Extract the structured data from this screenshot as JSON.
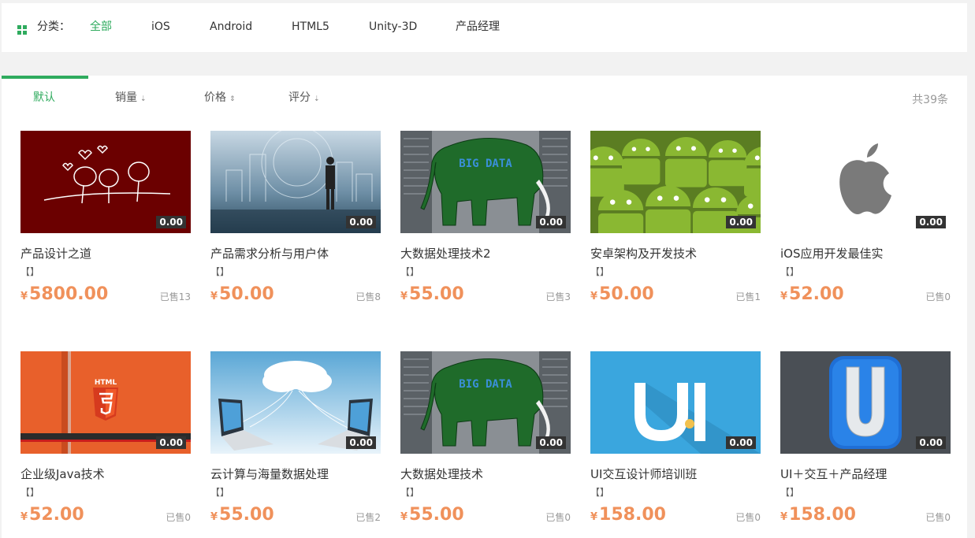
{
  "category": {
    "label": "分类：",
    "items": [
      {
        "label": "全部",
        "active": true
      },
      {
        "label": "iOS",
        "active": false
      },
      {
        "label": "Android",
        "active": false
      },
      {
        "label": "HTML5",
        "active": false
      },
      {
        "label": "Unity-3D",
        "active": false
      },
      {
        "label": "产品经理",
        "active": false
      }
    ]
  },
  "sort": {
    "items": [
      {
        "label": "默认",
        "arrow": "",
        "active": true
      },
      {
        "label": "销量",
        "arrow": "⇣",
        "active": false
      },
      {
        "label": "价格",
        "arrow": "⇕",
        "active": false
      },
      {
        "label": "评分",
        "arrow": "⇣",
        "active": false
      }
    ],
    "total": "共39条"
  },
  "courses": [
    {
      "title": "产品设计之道",
      "tag": "【】",
      "currency": "¥",
      "price": "5800.00",
      "sold": "已售13",
      "rating": "0.00",
      "thumb": "sketch"
    },
    {
      "title": "产品需求分析与用户体",
      "tag": "【】",
      "currency": "¥",
      "price": "50.00",
      "sold": "已售8",
      "rating": "0.00",
      "thumb": "businessman"
    },
    {
      "title": "大数据处理技术2",
      "tag": "【】",
      "currency": "¥",
      "price": "55.00",
      "sold": "已售3",
      "rating": "0.00",
      "thumb": "bigdata"
    },
    {
      "title": "安卓架构及开发技术",
      "tag": "【】",
      "currency": "¥",
      "price": "50.00",
      "sold": "已售1",
      "rating": "0.00",
      "thumb": "android"
    },
    {
      "title": "iOS应用开发最佳实",
      "tag": "【】",
      "currency": "¥",
      "price": "52.00",
      "sold": "已售0",
      "rating": "0.00",
      "thumb": "apple"
    },
    {
      "title": "企业级Java技术",
      "tag": "【】",
      "currency": "¥",
      "price": "52.00",
      "sold": "已售0",
      "rating": "0.00",
      "thumb": "html5"
    },
    {
      "title": "云计算与海量数据处理",
      "tag": "【】",
      "currency": "¥",
      "price": "55.00",
      "sold": "已售2",
      "rating": "0.00",
      "thumb": "cloud"
    },
    {
      "title": "大数据处理技术",
      "tag": "【】",
      "currency": "¥",
      "price": "55.00",
      "sold": "已售0",
      "rating": "0.00",
      "thumb": "bigdata"
    },
    {
      "title": "UI交互设计师培训班",
      "tag": "【】",
      "currency": "¥",
      "price": "158.00",
      "sold": "已售0",
      "rating": "0.00",
      "thumb": "ui"
    },
    {
      "title": "UI＋交互＋产品经理",
      "tag": "【】",
      "currency": "¥",
      "price": "158.00",
      "sold": "已售0",
      "rating": "0.00",
      "thumb": "u-logo"
    }
  ],
  "theme": {
    "accent": "#2fab5e",
    "price": "#f0915b"
  },
  "thumb_text": {
    "big_data": "BIG DATA",
    "html": "HTML"
  }
}
